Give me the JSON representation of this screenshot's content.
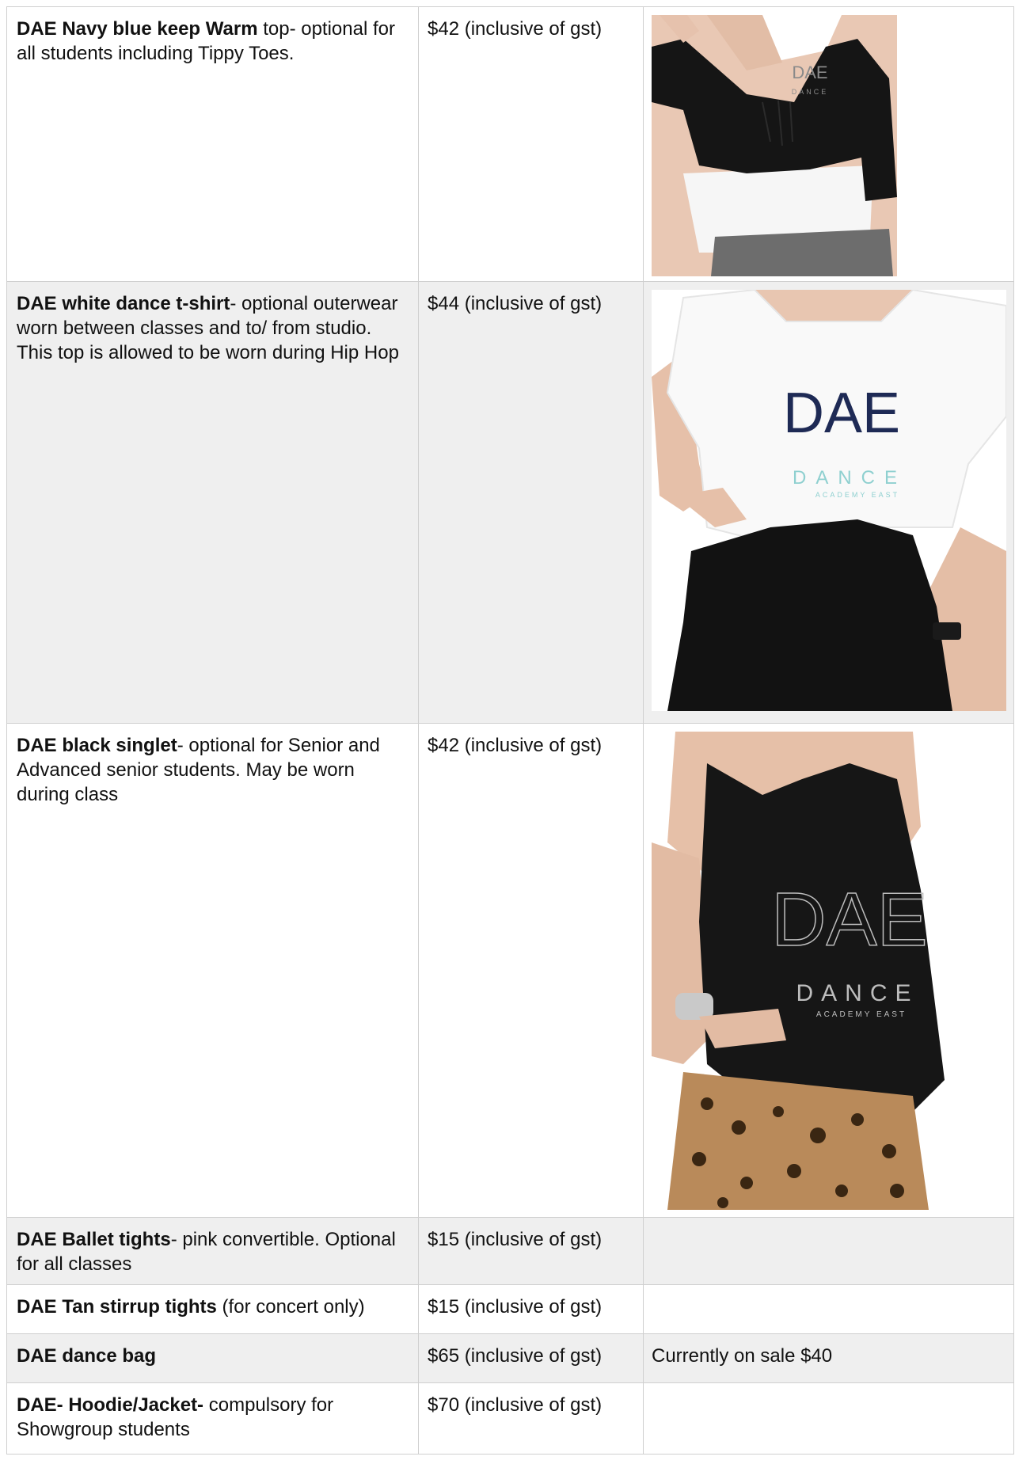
{
  "rows": [
    {
      "name": "DAE Navy blue keep Warm",
      "desc": "  top- optional for all students including Tippy Toes.",
      "price": "$42 (inclusive of gst)",
      "note": "",
      "photo": "keep-warm-top-photo"
    },
    {
      "name": "DAE white dance  t-shirt",
      "desc": "- optional outerwear worn between classes and to/ from studio. This top is allowed to be worn during Hip Hop",
      "price": "$44 (inclusive of gst)",
      "note": "",
      "photo": "white-tshirt-photo"
    },
    {
      "name": "DAE black singlet",
      "desc": "- optional for Senior and Advanced senior students. May be worn during class",
      "price": "$42 (inclusive of gst)",
      "note": "",
      "photo": "black-singlet-photo"
    },
    {
      "name": "DAE Ballet tights",
      "desc": "- pink convertible. Optional for all classes",
      "price": "$15 (inclusive of gst)",
      "note": ""
    },
    {
      "name": "DAE Tan stirrup tights",
      "desc": " (for concert only)",
      "price": "$15 (inclusive of gst)",
      "note": ""
    },
    {
      "name": "DAE dance bag",
      "desc": "",
      "price": "$65 (inclusive of gst)",
      "note": "Currently on sale $40"
    },
    {
      "name": "DAE- Hoodie/Jacket-",
      "desc": " compulsory for Showgroup students",
      "price": "$70 (inclusive of gst)",
      "note": ""
    }
  ],
  "logos": {
    "letters": "DAE",
    "word": "DANCE",
    "sub": "ACADEMY EAST"
  },
  "colors": {
    "row_alt": "#efefef",
    "border": "#cfcfcf",
    "navy": "#1e2a55",
    "teal": "#8fd0d0"
  }
}
